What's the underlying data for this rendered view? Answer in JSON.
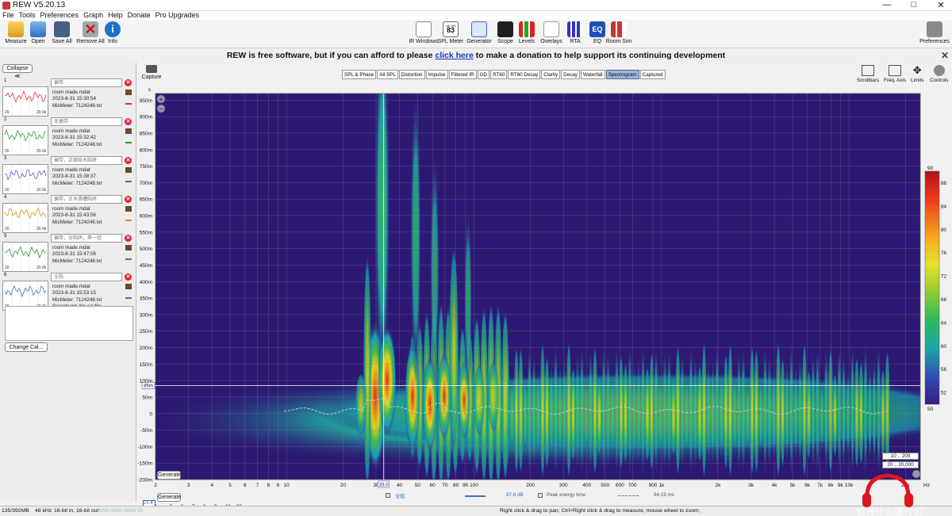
{
  "window": {
    "title": "REW V5.20.13",
    "controls": [
      "—",
      "□",
      "✕"
    ]
  },
  "menu": [
    "File",
    "Tools",
    "Preferences",
    "Graph",
    "Help",
    "Donate",
    "Pro Upgrades"
  ],
  "toolbar": {
    "left": [
      "Measure",
      "Open",
      "Save All",
      "Remove All",
      "Info"
    ],
    "center": [
      "IR Windows",
      "SPL Meter",
      "Generator",
      "Scope",
      "Levels",
      "Overlays",
      "RTA",
      "EQ",
      "Room Sim"
    ],
    "spl_value": "83",
    "spl_caption": "dB SPL",
    "right": "Preferences"
  },
  "banner": {
    "prefix": "REW is free software, but if you can afford to please",
    "link": "click here",
    "suffix": "to make a donation to help support its continuing development",
    "close": "✕"
  },
  "left_panel": {
    "collapse_label": "Collapse",
    "measurements": [
      {
        "index": "1",
        "note": "偏带",
        "name": "room made.mdat",
        "date": "2023-8-31 15:30:54",
        "mic": "MicMeter: 7124248.txt",
        "color": "#d33"
      },
      {
        "index": "2",
        "note": "无偏带",
        "name": "room made.mdat",
        "date": "2023-8-31 15:32:42",
        "mic": "MicMeter: 7124248.txt",
        "color": "#2a9a3a"
      },
      {
        "index": "3",
        "note": "偏带，正面吸木陷阱",
        "name": "room made.mdat",
        "date": "2023-8-31 15:38:37",
        "mic": "MicMeter: 7124248.txt",
        "color": "#5a5ad0"
      },
      {
        "index": "4",
        "note": "偏带，正木滑槽陷阱",
        "name": "room made.mdat",
        "date": "2023-8-31 15:43:56",
        "mic": "MicMeter: 7124248.txt",
        "color": "#e08a18"
      },
      {
        "index": "5",
        "note": "偏带，全陷阱，第一组",
        "name": "room made.mdat",
        "date": "2023-8-31 15:47:06",
        "mic": "MicMeter: 7124248.txt",
        "color": "#2a9a3a"
      },
      {
        "index": "6",
        "note": "全陷",
        "name": "room made.mdat",
        "date": "2023-8-31 15:53:15",
        "mic": "MicMeter: 7124248.txt",
        "soundcard": "Soundcard: No cal file",
        "color": "#3b72c8"
      }
    ],
    "thumb_x_start": "20",
    "thumb_x_end": "20.0k",
    "change_cal": "Change Cal..."
  },
  "graph": {
    "capture": "Capture",
    "tabs": [
      "SPL & Phase",
      "All SPL",
      "Distortion",
      "Impulse",
      "Filtered IR",
      "GD",
      "RT60",
      "RT60 Decay",
      "Clarity",
      "Decay",
      "Waterfall",
      "Spectrogram",
      "Captured"
    ],
    "active_tab": "Spectrogram",
    "right_tools": [
      "Scrollbars",
      "Freq. Axis",
      "Limits",
      "Controls"
    ],
    "y_unit": "s",
    "y_ticks": [
      "950m",
      "900m",
      "850m",
      "800m",
      "750m",
      "700m",
      "650m",
      "600m",
      "550m",
      "500m",
      "450m",
      "400m",
      "350m",
      "300m",
      "250m",
      "200m",
      "150m",
      "100m",
      "50m",
      "0",
      "-50m",
      "-100m",
      "-150m",
      "-200m"
    ],
    "x_ticks": [
      "2",
      "3",
      "4",
      "5",
      "6",
      "7",
      "8",
      "9",
      "10",
      "20",
      "30",
      "40",
      "50",
      "60",
      "70",
      "80",
      "90",
      "100",
      "200",
      "300",
      "400",
      "500",
      "600",
      "700",
      "900",
      "1k",
      "2k",
      "3k",
      "4k",
      "5k",
      "6k",
      "7k",
      "8k",
      "9k",
      "10k",
      "20k"
    ],
    "x_cursor": "33.0",
    "y_cursor": "85m",
    "generate": "Generate",
    "zoom_range_1": "10 .. 200",
    "zoom_range_2": "20 .. 20,000",
    "hz": "Hz",
    "colorbar": {
      "top": "90",
      "labels": [
        "88",
        "84",
        "80",
        "76",
        "72",
        "68",
        "64",
        "60",
        "56",
        "52"
      ],
      "bottom": "50"
    }
  },
  "legend": {
    "generate": "Generate",
    "y_readout": "21.4",
    "series_name": "全陷",
    "level": "87.8 dB",
    "peak_label": "Peak energy time",
    "peak_value": "84.19 ms",
    "lower_ticks": [
      "4",
      "5",
      "6",
      "7",
      "8",
      "9",
      "10",
      "20"
    ]
  },
  "status": {
    "memory": "135/392MB",
    "rate": "48 kHz",
    "bits": "16-bit in, 16-bit out",
    "levels": "0000 0000  0000 00",
    "hint": "Right click & drag to pan; Ctrl+Right click & drag to measure; mouse wheel to zoom;"
  },
  "watermark": "值得什么值得买"
}
